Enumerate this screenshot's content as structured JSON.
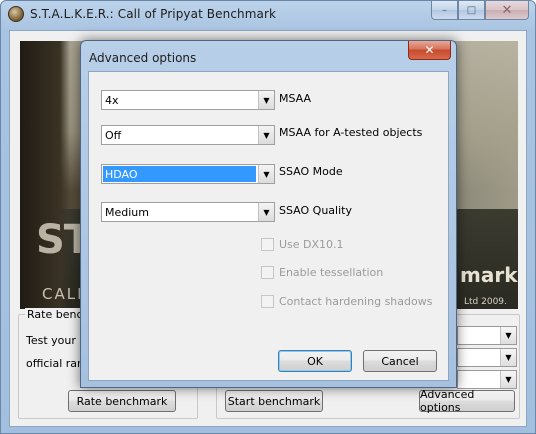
{
  "main_window": {
    "title": "S.T.A.L.K.E.R.: Call of Pripyat Benchmark",
    "caption_buttons": {
      "minimize": "–",
      "maximize": "□",
      "close": "✕"
    }
  },
  "banner": {
    "logo_left": "ST",
    "logo_call": "CALL",
    "logo_right": "mark",
    "copyright": "Ltd 2009."
  },
  "rate_group": {
    "title": "Rate bench",
    "line1": "Test your s",
    "line2": "official rank",
    "button": "Rate benchmark"
  },
  "bench_group": {
    "start_button": "Start benchmark",
    "advanced_button": "Advanced options"
  },
  "dialog": {
    "title": "Advanced options",
    "close": "✕",
    "combos": [
      {
        "value": "4x",
        "label": "MSAA"
      },
      {
        "value": "Off",
        "label": "MSAA for A-tested objects"
      },
      {
        "value": "HDAO",
        "label": "SSAO Mode"
      },
      {
        "value": "Medium",
        "label": "SSAO Quality"
      }
    ],
    "checkboxes": [
      {
        "label": "Use DX10.1",
        "checked": false,
        "enabled": false
      },
      {
        "label": "Enable tessellation",
        "checked": false,
        "enabled": false
      },
      {
        "label": "Contact hardening shadows",
        "checked": false,
        "enabled": false
      }
    ],
    "ok_button": "OK",
    "cancel_button": "Cancel",
    "combo_arrow": "▼"
  }
}
